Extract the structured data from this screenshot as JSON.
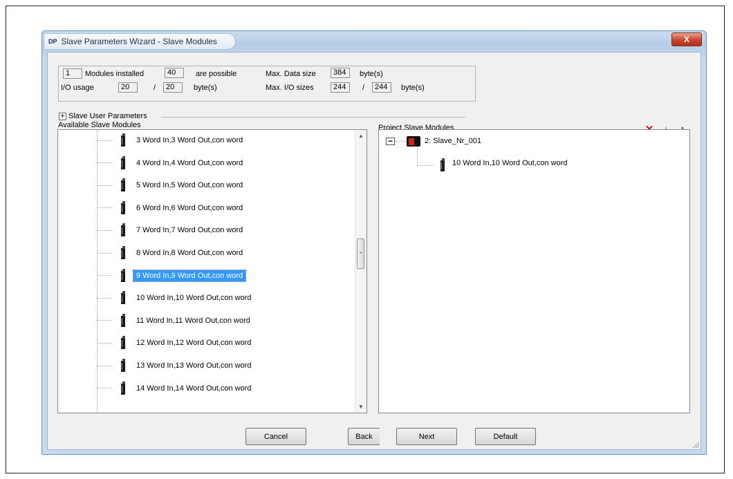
{
  "window": {
    "app_badge": "DP",
    "title": "Slave Parameters Wizard - Slave Modules",
    "close_glyph": "X"
  },
  "info": {
    "modules_installed_value": "1",
    "modules_installed_label": "Modules installed",
    "possible_value": "40",
    "possible_label": "are possible",
    "max_data_size_label": "Max. Data size",
    "max_data_size_value": "384",
    "max_data_size_unit": "byte(s)",
    "io_usage_label": "I/O usage",
    "io_usage_value": "20",
    "io_usage_sep": "/",
    "io_usage_total": "20",
    "io_usage_unit": "byte(s)",
    "max_io_sizes_label": "Max. I/O sizes",
    "max_io_in": "244",
    "max_io_sep": "/",
    "max_io_out": "244",
    "max_io_unit": "byte(s)"
  },
  "slave_user_parameters": {
    "toggle": "+",
    "label": "Slave User Parameters"
  },
  "available": {
    "label": "Available Slave Modules",
    "items": [
      "3 Word In,3 Word Out,con word",
      "4 Word In,4 Word Out,con word",
      "5 Word In,5 Word Out,con word",
      "6 Word In,6 Word Out,con word",
      "7 Word In,7 Word Out,con word",
      "8 Word In,8 Word Out,con word",
      "9 Word In,9 Word Out,con word",
      "10 Word In,10 Word Out,con word",
      "11 Word In,11 Word Out,con word",
      "12 Word In,12 Word Out,con word",
      "13 Word In,13 Word Out,con word",
      "14 Word In,14 Word Out,con word"
    ],
    "selected_index": 6,
    "scroll_position": 0.42
  },
  "project": {
    "label": "Project Slave Modules",
    "slave_name": "2: Slave_Nr_001",
    "module": "10 Word In,10 Word Out,con word",
    "delete_glyph": "✕",
    "down_glyph": "↓",
    "up_glyph": "↑"
  },
  "buttons": {
    "cancel": "Cancel",
    "back": "Back",
    "next": "Next",
    "default": "Default"
  },
  "colors": {
    "selection": "#3399ff",
    "delete": "#cc1010",
    "slave_icon_red": "#d0261a"
  }
}
